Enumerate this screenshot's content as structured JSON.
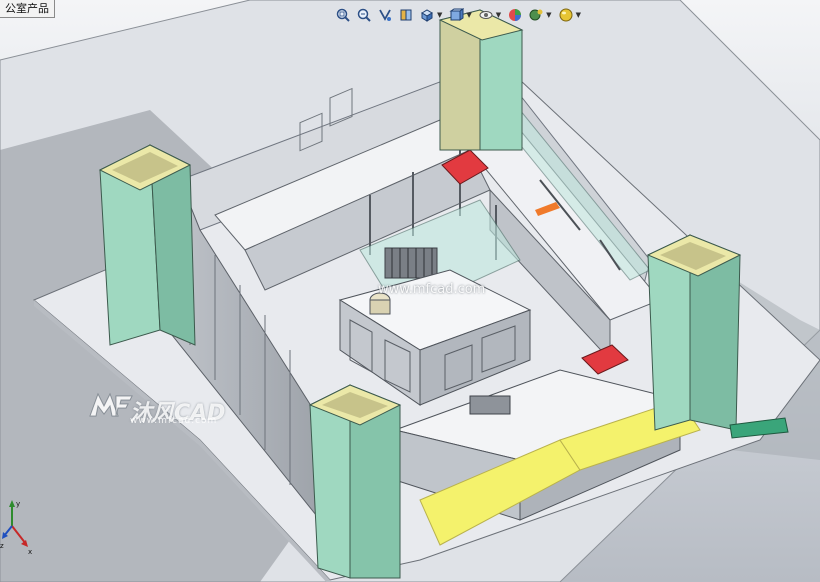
{
  "feature_tree": {
    "tab_label": "公室产品"
  },
  "view_toolbar": {
    "tools": [
      {
        "name": "zoom-to-fit",
        "icon": "zoom-fit-icon",
        "has_dropdown": false
      },
      {
        "name": "zoom-to-area",
        "icon": "zoom-area-icon",
        "has_dropdown": false
      },
      {
        "name": "previous-view",
        "icon": "previous-view-icon",
        "has_dropdown": false
      },
      {
        "name": "section-view",
        "icon": "section-view-icon",
        "has_dropdown": false
      },
      {
        "name": "view-orientation",
        "icon": "view-orientation-icon",
        "has_dropdown": true
      },
      {
        "name": "display-style",
        "icon": "display-style-icon",
        "has_dropdown": true
      },
      {
        "name": "hide-show-items",
        "icon": "hide-show-icon",
        "has_dropdown": true
      },
      {
        "name": "edit-appearance",
        "icon": "appearance-icon",
        "has_dropdown": false
      },
      {
        "name": "apply-scene",
        "icon": "scene-icon",
        "has_dropdown": true
      },
      {
        "name": "view-settings",
        "icon": "view-settings-icon",
        "has_dropdown": true
      }
    ]
  },
  "watermark": {
    "logo_text": "沐风CAD",
    "url_text": "www.mfcad.com",
    "center_text": "www.mfcad.com"
  },
  "colors": {
    "pillar_green": "#9fd8c0",
    "pillar_top": "#e8e6a8",
    "counter_white": "#eef0f3",
    "yellow_strip": "#f3f06a",
    "red_accent": "#d8323c",
    "floor": "#e6e8ec"
  },
  "triad": {
    "axes": [
      "x",
      "y",
      "z"
    ]
  }
}
